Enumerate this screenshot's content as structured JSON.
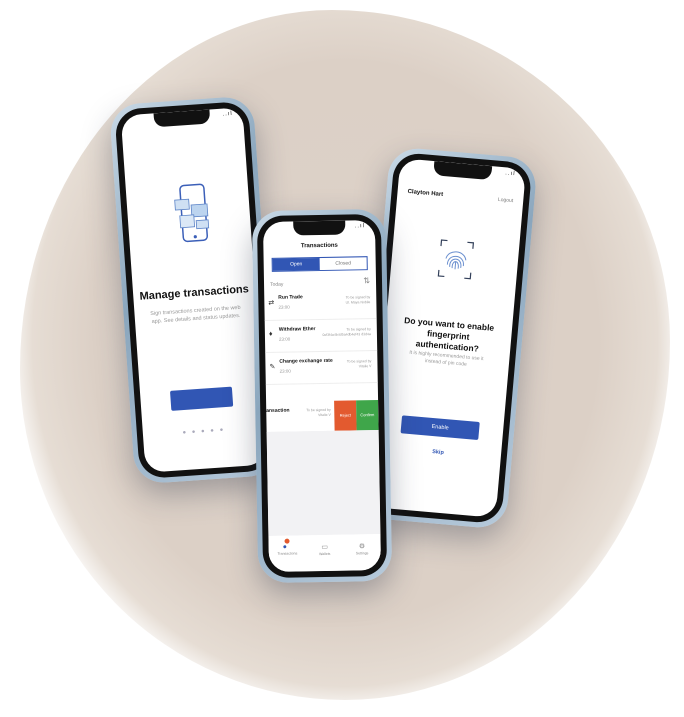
{
  "status_bar": {
    "time": "",
    "signal": "..ıl"
  },
  "onboarding": {
    "title": "Manage transactions",
    "description": "Sign transactions created on the web app. See details and status updates.",
    "cta_label": "",
    "pager": "● ● ● ● ●"
  },
  "transactions": {
    "header": "Transactions",
    "tabs": [
      "Open",
      "Closed"
    ],
    "section": "Today",
    "items": [
      {
        "name": "Run Trade",
        "time": "23:00",
        "status": "To be signed by",
        "status_detail": "Ul. Maya Nobile"
      },
      {
        "name": "Withdraw Ether",
        "time": "23:00",
        "status": "To be signed by",
        "status_detail": "0xf3f4a4b4d5a4db4ef43 d3d4a"
      },
      {
        "name": "Change exchange rate",
        "time": "23:00",
        "status": "To be signed by",
        "status_detail": "Vitalie V"
      }
    ],
    "swiped_item": {
      "name": "ransaction",
      "status": "To be signed by",
      "status_detail": "Vitalie V",
      "reject_label": "Reject",
      "confirm_label": "Confirm"
    },
    "tabbar": [
      {
        "label": "Transactions",
        "icon": "transactions-icon",
        "active": true
      },
      {
        "label": "Wallets",
        "icon": "wallet-icon",
        "active": false
      },
      {
        "label": "Settings",
        "icon": "settings-icon",
        "active": false
      }
    ]
  },
  "fingerprint": {
    "user_name": "Clayton Hart",
    "logout_label": "Logout",
    "question": "Do you want to enable fingerprint authentication?",
    "hint": "It is highly recommended to use it instead of pin code",
    "enable_label": "Enable",
    "skip_label": "Skip"
  },
  "colors": {
    "accent": "#3156b4",
    "reject": "#e35a2f",
    "confirm": "#3fa64a"
  }
}
